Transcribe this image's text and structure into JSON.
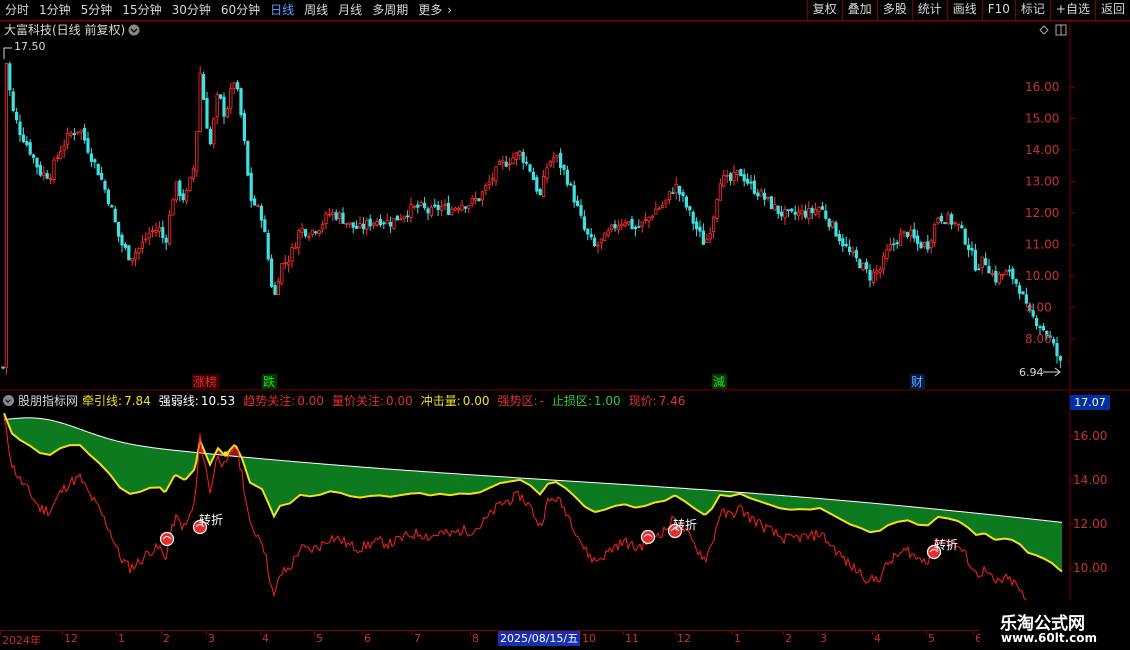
{
  "toolbar": {
    "periods": [
      "分时",
      "1分钟",
      "5分钟",
      "15分钟",
      "30分钟",
      "60分钟",
      "日线",
      "周线",
      "月线",
      "多周期",
      "更多"
    ],
    "active_period": "日线",
    "tools": [
      "复权",
      "叠加",
      "多股",
      "统计",
      "画线",
      "F10",
      "标记",
      "+自选",
      "返回"
    ]
  },
  "main_chart": {
    "title": "大富科技(日线 前复权)",
    "high_marker": "17.50",
    "low_marker": "6.94",
    "y_ticks": [
      "16.00",
      "15.00",
      "14.00",
      "13.00",
      "12.00",
      "11.00",
      "10.00",
      "9.00",
      "8.00"
    ],
    "events": [
      {
        "label": "涨榜",
        "color": "#e03030",
        "bg": "#3a0000"
      },
      {
        "label": "跌",
        "color": "#30d030",
        "bg": "#003a00"
      },
      {
        "label": "減",
        "color": "#30d030",
        "bg": "#003a00"
      },
      {
        "label": "财",
        "color": "#6aa8ff",
        "bg": "#001a4a"
      }
    ]
  },
  "indicator": {
    "name": "股朋指标网",
    "fields": [
      {
        "label": "牵引线:",
        "value": "7.84",
        "color": "#f0e020"
      },
      {
        "label": "强弱线:",
        "value": "10.53",
        "color": "#ffffff"
      },
      {
        "label": "趋势关注:",
        "value": "0.00",
        "color": "#e03030"
      },
      {
        "label": "量价关注:",
        "value": "0.00",
        "color": "#e03030"
      },
      {
        "label": "冲击量:",
        "value": "0.00",
        "color": "#f0e020"
      },
      {
        "label": "强势区:",
        "value": "-",
        "color": "#e03030"
      },
      {
        "label": "止损区:",
        "value": "1.00",
        "color": "#30d030"
      },
      {
        "label": "现价:",
        "value": "7.46",
        "color": "#e03030"
      }
    ],
    "price_tag": "17.07",
    "y_ticks": [
      "16.00",
      "14.00",
      "12.00",
      "10.00"
    ],
    "signal_label": "转折"
  },
  "date_axis": {
    "labels": [
      "2024年",
      "12",
      "1",
      "2",
      "3",
      "4",
      "5",
      "6",
      "7",
      "8",
      "10",
      "11",
      "12",
      "1",
      "2",
      "3",
      "4",
      "5",
      "6"
    ],
    "current_date": "2025/08/15/五"
  },
  "watermark": {
    "title": "乐淘公式网",
    "url": "www.60lt.com"
  },
  "colors": {
    "up": "#ff3030",
    "down": "#40e0e0",
    "frame": "#7a0000",
    "green_fill": "#0e7a20",
    "red_fill": "#8a1a1a"
  }
}
